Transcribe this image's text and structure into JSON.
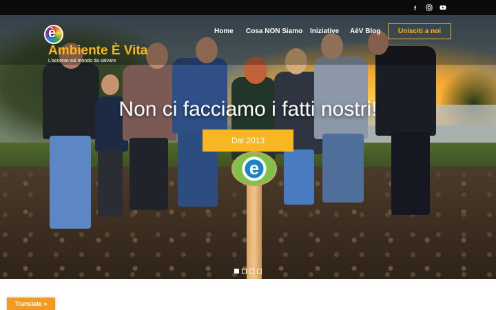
{
  "topbar": {
    "social": [
      {
        "icon": "facebook-icon",
        "glyph": "f"
      },
      {
        "icon": "instagram-icon",
        "glyph": "◎"
      },
      {
        "icon": "youtube-icon",
        "glyph": "▶"
      }
    ]
  },
  "logo": {
    "badge_letter": "è",
    "title": "Ambiente È Vita",
    "tagline": "L'accento sul mondo da salvare"
  },
  "nav": {
    "items": [
      "Home",
      "Cosa NON Siamo",
      "Iniziative",
      "AèV Blog"
    ],
    "cta": "Unisciti a noi"
  },
  "hero": {
    "headline": "Non ci facciamo i fatti nostri!",
    "button": "Dal 2013",
    "sign_letter": "e",
    "slides": 4,
    "active_slide": 1
  },
  "translate": {
    "label": "Translate »"
  },
  "colors": {
    "accent": "#f9b623",
    "topbar": "#0b0b0b",
    "translate": "#f39a24"
  }
}
